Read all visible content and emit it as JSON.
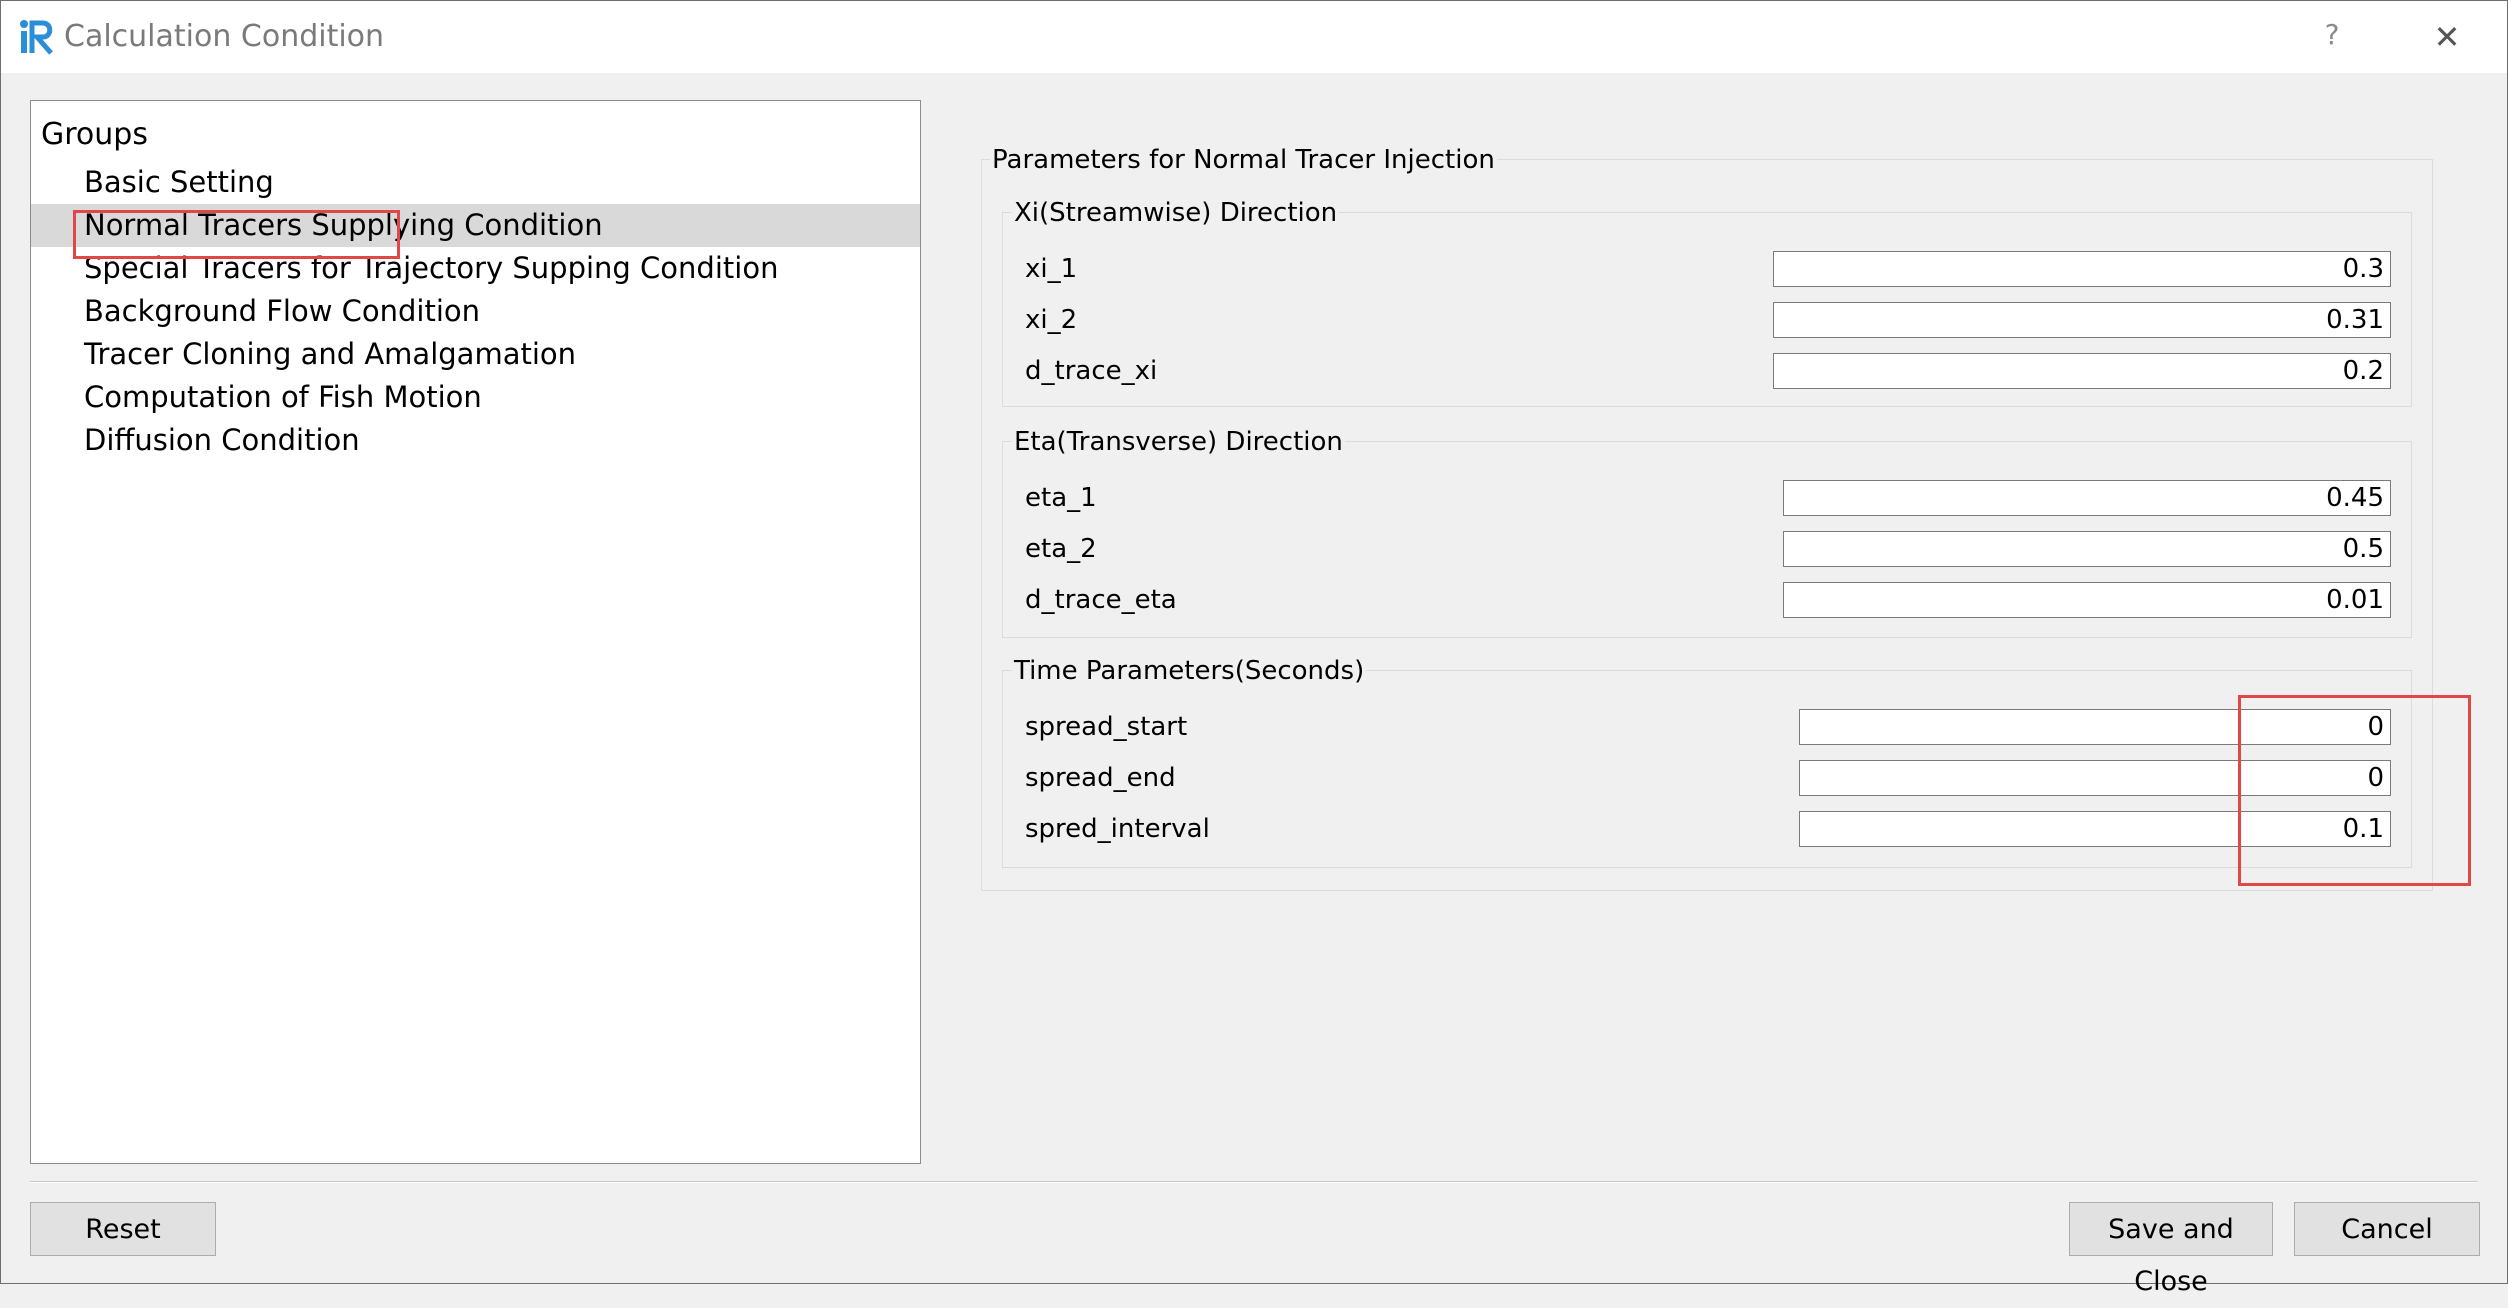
{
  "window": {
    "title": "Calculation Condition",
    "help_label": "?",
    "close_label": "✕"
  },
  "groups": {
    "header": "Groups",
    "items": [
      {
        "label": "Basic Setting"
      },
      {
        "label": "Normal Tracers Supplying Condition"
      },
      {
        "label": "Special Tracers for Trajectory Supping Condition"
      },
      {
        "label": "Background Flow Condition"
      },
      {
        "label": "Tracer Cloning and Amalgamation"
      },
      {
        "label": "Computation of Fish Motion"
      },
      {
        "label": "Diffusion Condition"
      }
    ],
    "selected_index": 1
  },
  "params": {
    "title": "Parameters for Normal Tracer Injection",
    "xi": {
      "title": "Xi(Streamwise) Direction",
      "fields": [
        {
          "label": "xi_1",
          "value": "0.3"
        },
        {
          "label": "xi_2",
          "value": "0.31"
        },
        {
          "label": "d_trace_xi",
          "value": "0.2"
        }
      ]
    },
    "eta": {
      "title": "Eta(Transverse) Direction",
      "fields": [
        {
          "label": "eta_1",
          "value": "0.45"
        },
        {
          "label": "eta_2",
          "value": "0.5"
        },
        {
          "label": "d_trace_eta",
          "value": "0.01"
        }
      ]
    },
    "time": {
      "title": "Time Parameters(Seconds)",
      "fields": [
        {
          "label": "spread_start",
          "value": "0"
        },
        {
          "label": "spread_end",
          "value": "0"
        },
        {
          "label": "spred_interval",
          "value": "0.1"
        }
      ]
    }
  },
  "buttons": {
    "reset": "Reset",
    "save_close": "Save and Close",
    "cancel": "Cancel"
  },
  "colors": {
    "highlight": "#e04848",
    "selection": "#d9d9d9",
    "dialog_bg": "#f0f0f0"
  }
}
